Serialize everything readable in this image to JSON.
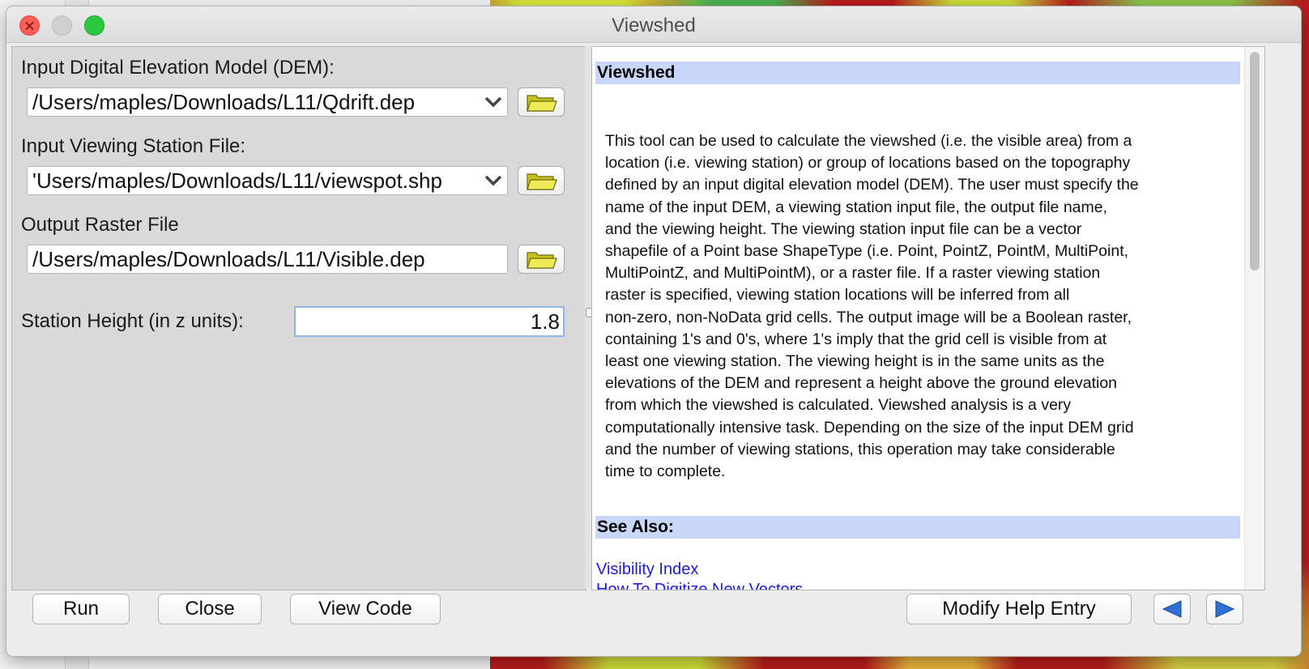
{
  "window": {
    "title": "Viewshed"
  },
  "form": {
    "dem_label": "Input Digital Elevation Model (DEM):",
    "dem_value": "/Users/maples/Downloads/L11/Qdrift.dep",
    "station_label": "Input Viewing Station File:",
    "station_value": "'Users/maples/Downloads/L11/viewspot.shp",
    "output_label": "Output Raster File",
    "output_value": "/Users/maples/Downloads/L11/Visible.dep",
    "height_label": "Station Height (in z units):",
    "height_value": "1.8"
  },
  "help": {
    "heading": "Viewshed",
    "lines": [
      "This tool can be used to calculate the viewshed (i.e. the visible area) from a",
      "location (i.e. viewing station) or group of locations based on the topography",
      "defined by an input digital elevation model (DEM). The user must specify the",
      "name of the input DEM, a viewing station input file, the output file name,",
      "and the viewing height. The viewing station input file can be a vector",
      "shapefile of a Point base ShapeType (i.e. Point, PointZ, PointM, MultiPoint,",
      "MultiPointZ, and MultiPointM), or a raster file. If a raster viewing station",
      "raster is specified, viewing station locations will be inferred from all",
      "non-zero, non-NoData grid cells. The output image will be a Boolean raster,",
      "containing 1's and 0's, where 1's imply that the grid cell is visible from at",
      "least one viewing station. The viewing height is in the same units as the",
      "elevations of the DEM and represent a height above the ground elevation",
      "from which the viewshed is calculated. Viewshed analysis is a very",
      "computationally intensive task. Depending on the size of the input DEM grid",
      "and the number of viewing stations, this operation may take considerable",
      "time to complete."
    ],
    "see_also": "See Also:",
    "link1": "Visibility Index",
    "link2": "How To Digitize New Vectors"
  },
  "buttons": {
    "run": "Run",
    "close": "Close",
    "view_code": "View Code",
    "modify_help": "Modify Help Entry"
  },
  "colors": {
    "help_heading_bg": "#c7d6f9",
    "link": "#1a1ae6",
    "nav_arrow": "#2f6fd6"
  }
}
